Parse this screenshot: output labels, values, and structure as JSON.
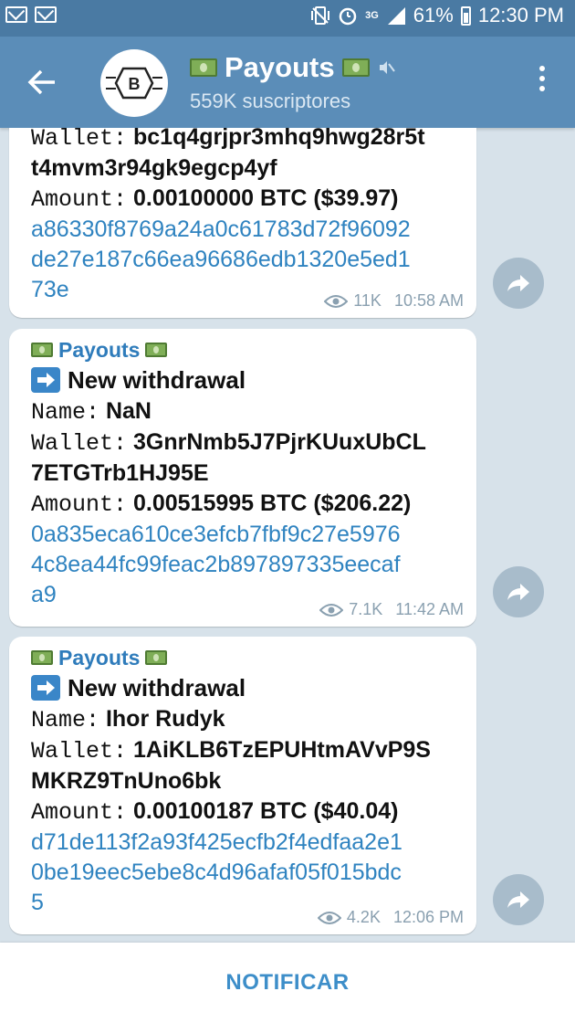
{
  "status_bar": {
    "network": "3G",
    "battery": "61%",
    "time": "12:30 PM"
  },
  "header": {
    "title": "Payouts",
    "subscribers": "559K suscriptores"
  },
  "messages": [
    {
      "wallet_label": "Wallet:",
      "wallet_lines": [
        "bc1q4grjpr3mhq9hwg28r5t",
        "t4mvm3r94gk9egcp4yf"
      ],
      "amount_label": "Amount:",
      "amount": "0.00100000 BTC ($39.97)",
      "tx_lines": [
        "a86330f8769a24a0c61783d72f96092",
        "de27e187c66ea96686edb1320e5ed1",
        "73e"
      ],
      "views": "11K",
      "time": "10:58 AM"
    },
    {
      "channel": "Payouts",
      "heading": "New withdrawal",
      "name_label": "Name:",
      "name": "NaN",
      "wallet_label": "Wallet:",
      "wallet_lines": [
        "3GnrNmb5J7PjrKUuxUbCL",
        "7ETGTrb1HJ95E"
      ],
      "amount_label": "Amount:",
      "amount": "0.00515995 BTC ($206.22)",
      "tx_lines": [
        "0a835eca610ce3efcb7fbf9c27e5976",
        "4c8ea44fc99feac2b897897335eecaf",
        "a9"
      ],
      "views": "7.1K",
      "time": "11:42 AM"
    },
    {
      "channel": "Payouts",
      "heading": "New withdrawal",
      "name_label": "Name:",
      "name": "Ihor Rudyk",
      "wallet_label": "Wallet:",
      "wallet_lines": [
        "1AiKLB6TzEPUHtmAVvP9S",
        "MKRZ9TnUno6bk"
      ],
      "amount_label": "Amount:",
      "amount": "0.00100187 BTC ($40.04)",
      "tx_lines": [
        "d71de113f2a93f425ecfb2f4edfaa2e1",
        "0be19eec5ebe8c4d96afaf05f015bdc",
        "5"
      ],
      "views": "4.2K",
      "time": "12:06 PM"
    }
  ],
  "bottom": {
    "notify_label": "NOTIFICAR"
  },
  "colors": {
    "header_bg": "#5b8db8",
    "status_bg": "#4a7aa3",
    "link": "#2f83c0",
    "chat_bg": "#d7e2ea"
  }
}
